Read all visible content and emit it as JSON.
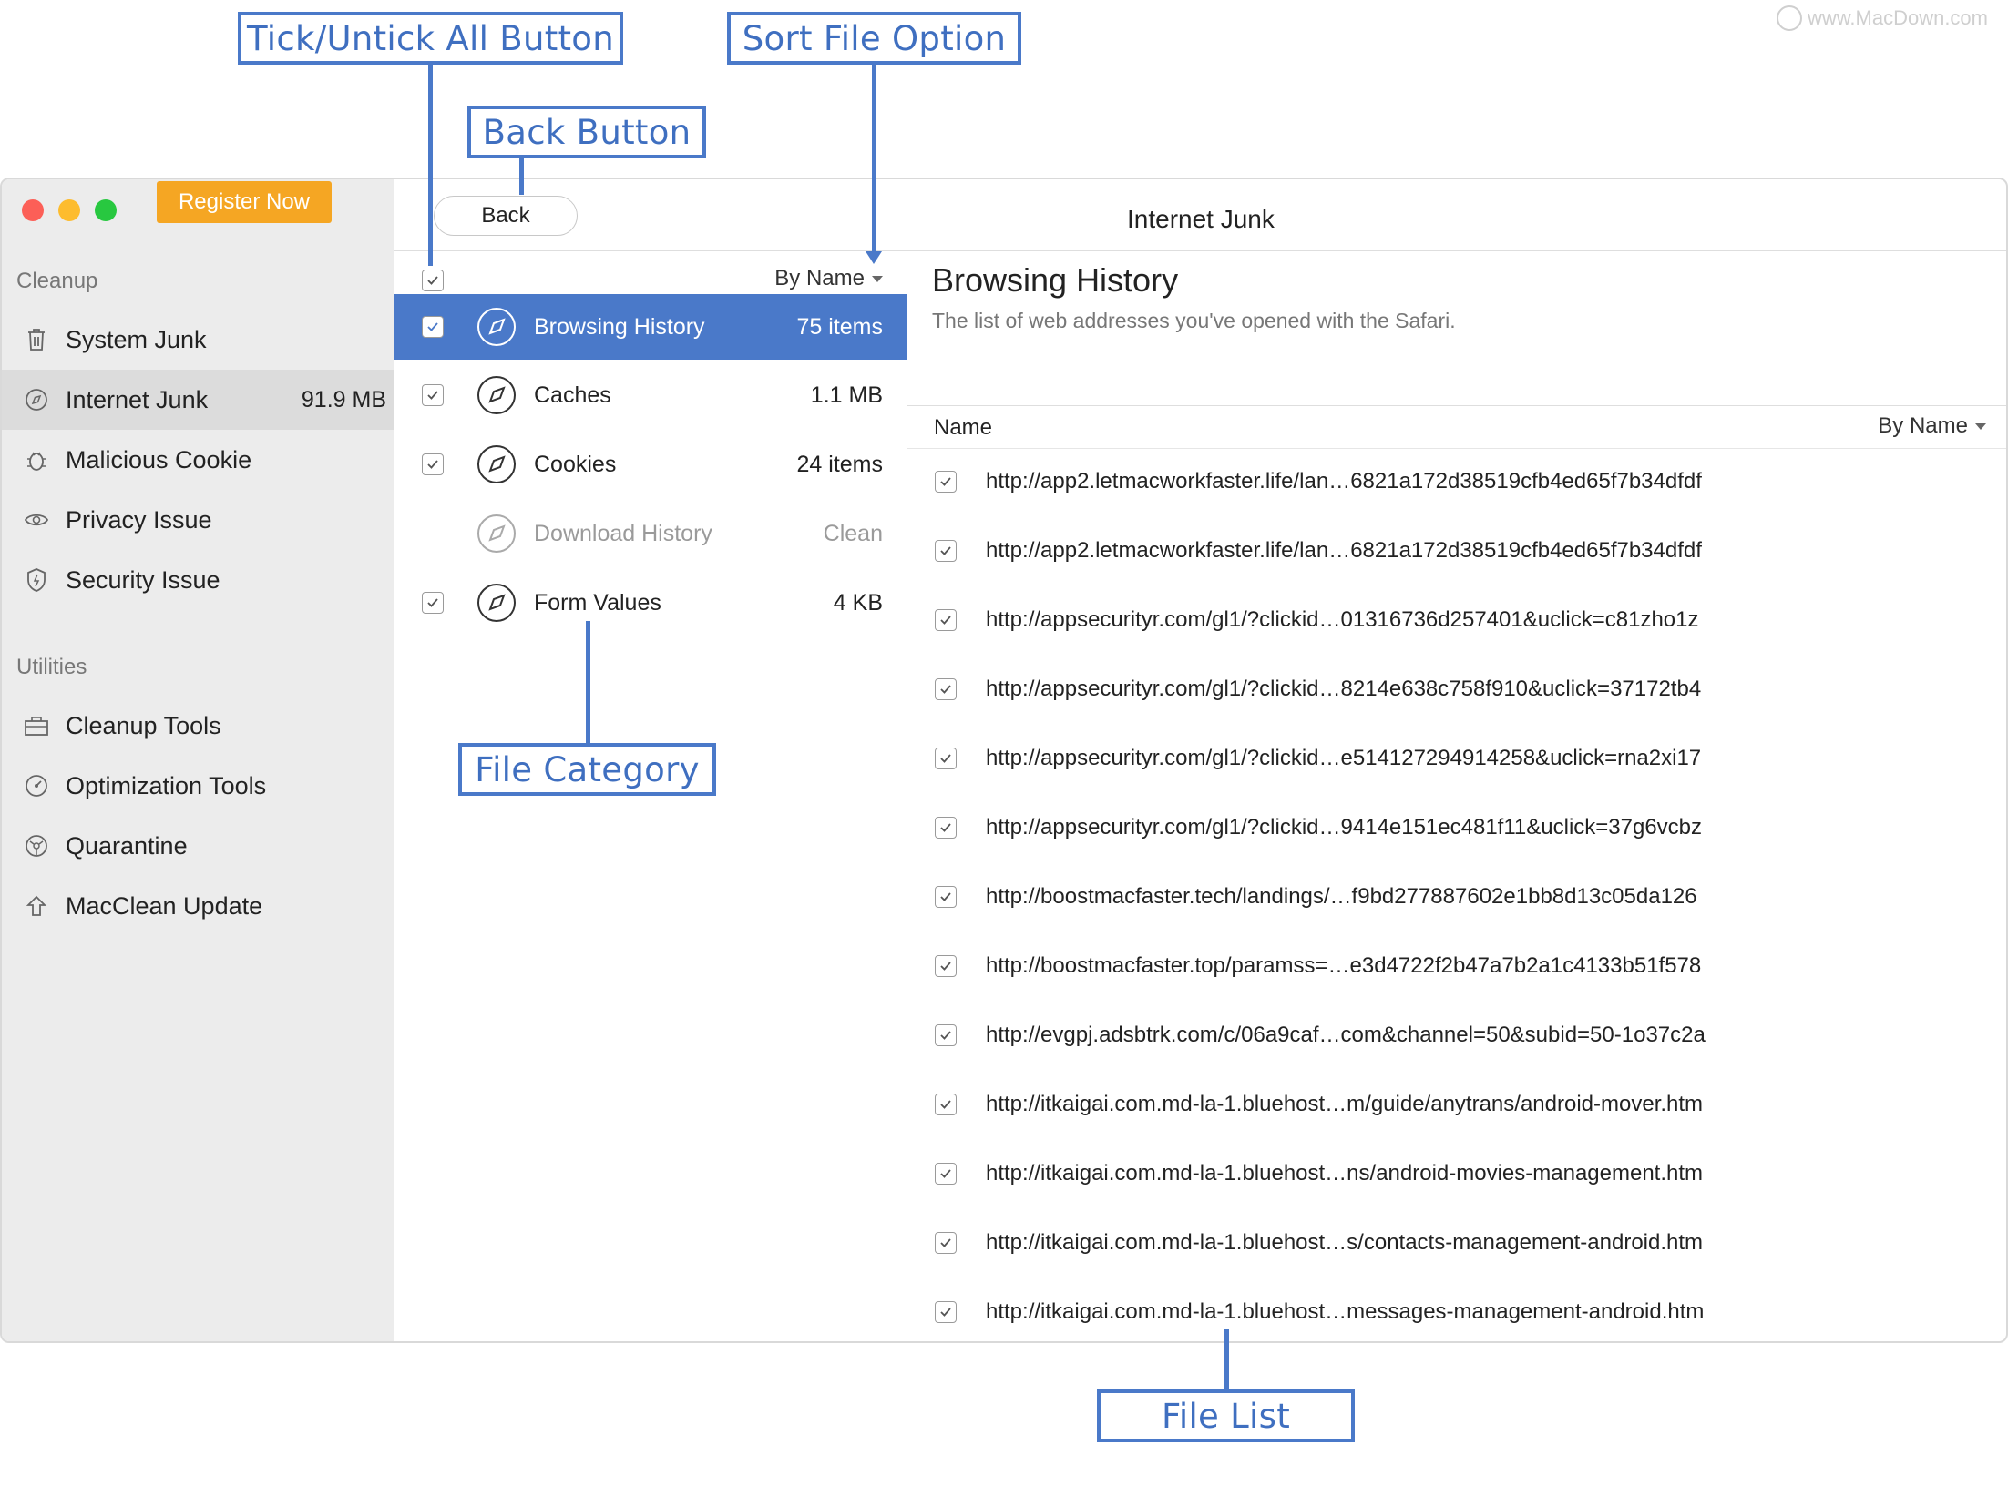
{
  "watermark": "www.MacDown.com",
  "callouts": {
    "tick_all": "Tick/Untick All Button",
    "sort": "Sort File Option",
    "back": "Back Button",
    "category": "File Category",
    "file_list": "File List"
  },
  "window": {
    "title": "Internet Junk",
    "register_label": "Register Now",
    "back_label": "Back"
  },
  "sidebar": {
    "cleanup_label": "Cleanup",
    "utilities_label": "Utilities",
    "cleanup_items": [
      {
        "label": "System Junk",
        "icon": "trash-icon"
      },
      {
        "label": "Internet Junk",
        "size": "91.9 MB",
        "icon": "compass-icon"
      },
      {
        "label": "Malicious Cookie",
        "icon": "bug-icon"
      },
      {
        "label": "Privacy Issue",
        "icon": "eye-icon"
      },
      {
        "label": "Security Issue",
        "icon": "shield-icon"
      }
    ],
    "utility_items": [
      {
        "label": "Cleanup Tools",
        "icon": "toolbox-icon"
      },
      {
        "label": "Optimization Tools",
        "icon": "gauge-icon"
      },
      {
        "label": "Quarantine",
        "icon": "biohazard-icon"
      },
      {
        "label": "MacClean Update",
        "icon": "upload-arrow-icon"
      }
    ]
  },
  "categories": {
    "sort_label": "By Name",
    "items": [
      {
        "name": "Browsing History",
        "size": "75 items",
        "checked": true
      },
      {
        "name": "Caches",
        "size": "1.1 MB",
        "checked": true
      },
      {
        "name": "Cookies",
        "size": "24 items",
        "checked": true
      },
      {
        "name": "Download History",
        "size": "Clean",
        "checked": false
      },
      {
        "name": "Form Values",
        "size": "4 KB",
        "checked": true
      }
    ]
  },
  "detail": {
    "title": "Browsing History",
    "subtitle": "The list of web addresses you've opened with the Safari.",
    "column_name": "Name",
    "sort_label": "By Name",
    "files": [
      "http://app2.letmacworkfaster.life/lan…6821a172d38519cfb4ed65f7b34dfdf",
      "http://app2.letmacworkfaster.life/lan…6821a172d38519cfb4ed65f7b34dfdf",
      "http://appsecurityr.com/gl1/?clickid…01316736d257401&uclick=c81zho1z",
      "http://appsecurityr.com/gl1/?clickid…8214e638c758f910&uclick=37172tb4",
      "http://appsecurityr.com/gl1/?clickid…e514127294914258&uclick=rna2xi17",
      "http://appsecurityr.com/gl1/?clickid…9414e151ec481f11&uclick=37g6vcbz",
      "http://boostmacfaster.tech/landings/…f9bd277887602e1bb8d13c05da126",
      "http://boostmacfaster.top/paramss=…e3d4722f2b47a7b2a1c4133b51f578",
      "http://evgpj.adsbtrk.com/c/06a9caf…com&channel=50&subid=50-1o37c2a",
      "http://itkaigai.com.md-la-1.bluehost…m/guide/anytrans/android-mover.htm",
      "http://itkaigai.com.md-la-1.bluehost…ns/android-movies-management.htm",
      "http://itkaigai.com.md-la-1.bluehost…s/contacts-management-android.htm",
      "http://itkaigai.com.md-la-1.bluehost…messages-management-android.htm"
    ]
  },
  "colors": {
    "accent": "#4a79c9",
    "register": "#f5a623",
    "close": "#fc5f57",
    "minimize": "#fdbc2e",
    "zoom": "#28c840"
  }
}
